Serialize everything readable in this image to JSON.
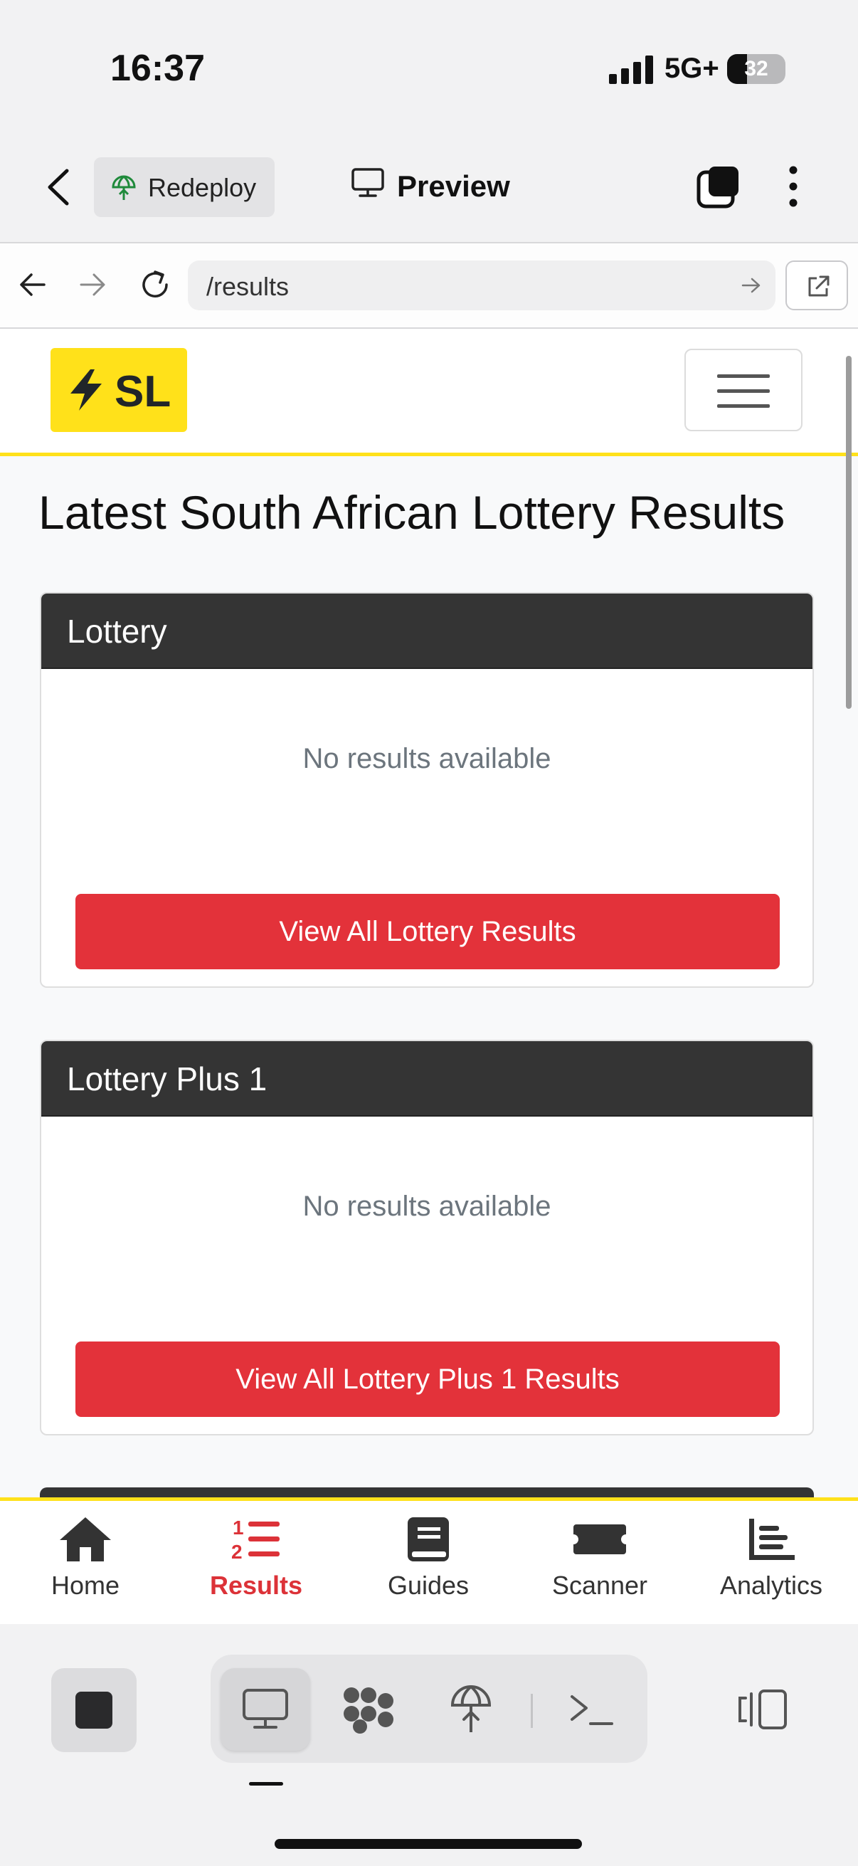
{
  "status_bar": {
    "time": "16:37",
    "network": "5G+",
    "battery": "32"
  },
  "editor_top": {
    "redeploy_label": "Redeploy",
    "preview_label": "Preview"
  },
  "address_bar": {
    "url": "/results"
  },
  "site": {
    "logo_text": "SL",
    "page_title": "Latest South African Lottery Results",
    "cards": [
      {
        "title": "Lottery",
        "empty_text": "No results available",
        "button_label": "View All Lottery Results"
      },
      {
        "title": "Lottery Plus 1",
        "empty_text": "No results available",
        "button_label": "View All Lottery Plus 1 Results"
      }
    ],
    "tabs": [
      {
        "label": "Home",
        "icon": "home-icon",
        "active": false
      },
      {
        "label": "Results",
        "icon": "ordered-list-icon",
        "active": true
      },
      {
        "label": "Guides",
        "icon": "book-icon",
        "active": false
      },
      {
        "label": "Scanner",
        "icon": "ticket-icon",
        "active": false
      },
      {
        "label": "Analytics",
        "icon": "bar-chart-icon",
        "active": false
      }
    ],
    "accent_color": "#ffe11a",
    "danger_color": "#e3323a",
    "header_color": "#343434"
  },
  "editor_bottom": {
    "tools": [
      "stop-icon",
      "monitor-icon",
      "workflow-icon",
      "deploy-icon",
      "terminal-icon",
      "panels-icon"
    ]
  }
}
